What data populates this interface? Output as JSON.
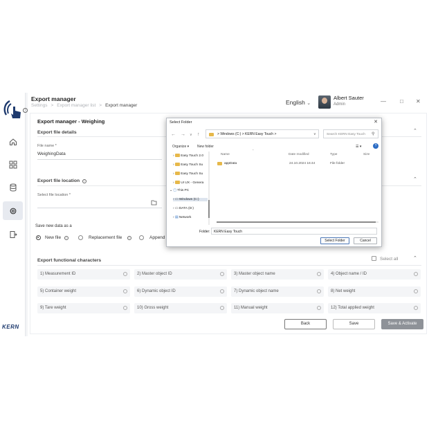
{
  "header": {
    "title": "Export manager",
    "breadcrumb": [
      "Settings",
      "Export manager list",
      "Export manager"
    ],
    "language": "English",
    "user_name": "Albert Sauter",
    "user_role": "Admin"
  },
  "page": {
    "title": "Export manager - Weighing",
    "file_details_heading": "Export file details",
    "file_name_label": "File name *",
    "file_name_value": "WeighingData",
    "file_location_heading": "Export file location",
    "select_location_label": "Select file location *",
    "save_new_data_label": "Save new data as a",
    "options": [
      "New file",
      "Replacement file",
      "Append f"
    ],
    "functional_heading": "Export functional characters",
    "select_all": "Select all",
    "characters": [
      "1) Measurement ID",
      "2) Master object ID",
      "3) Master object name",
      "4) Object name / ID",
      "5) Container weight",
      "6) Dynamic object ID",
      "7) Dynamic object name",
      "8) Net weight",
      "9) Tare weight",
      "10) Gross weight",
      "11) Manual weight",
      "12) Total applied weight"
    ],
    "buttons": {
      "back": "Back",
      "save": "Save",
      "save_activate": "Save & Activate"
    }
  },
  "dialog": {
    "title": "Select Folder",
    "address": [
      "Windows (C:)",
      "KERN Easy Touch"
    ],
    "search_placeholder": "Search KERN Easy Touch",
    "organize": "Organize ▾",
    "new_folder": "New folder",
    "tree": [
      "Easy Touch 2.0",
      "Easy Touch Su",
      "Easy Touch Su",
      "UI UX - Genera",
      "This PC",
      "Windows (C:)",
      "DATA (D:)",
      "Network"
    ],
    "columns": [
      "Name",
      "Date modified",
      "Type",
      "Size"
    ],
    "rows": [
      {
        "name": "appData",
        "date": "24.10.2024 16:44",
        "type": "File folder"
      }
    ],
    "folder_label": "Folder:",
    "folder_value": "KERN Easy Touch",
    "select_button": "Select Folder",
    "cancel_button": "Cancel"
  },
  "brand": {
    "logo_text": "KERN",
    "accent": "#1e3a6e"
  }
}
